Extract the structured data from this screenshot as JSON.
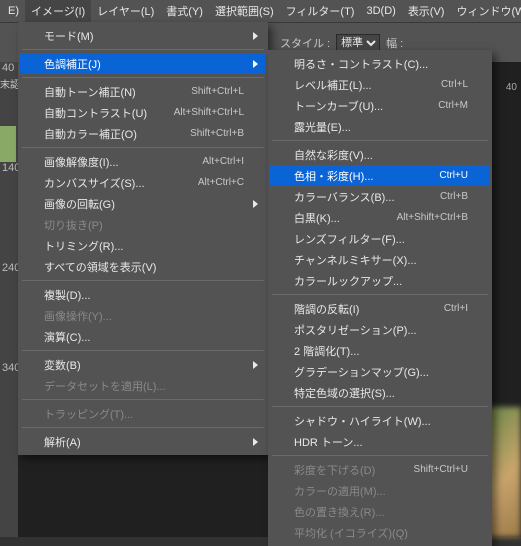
{
  "topbar": {
    "items": [
      "E)",
      "イメージ(I)",
      "レイヤー(L)",
      "書式(Y)",
      "選択範囲(S)",
      "フィルター(T)",
      "3D(D)",
      "表示(V)",
      "ウィンドウ(W)"
    ]
  },
  "optbar": {
    "style_label": "スタイル :",
    "style_value": "標準",
    "width_label": "幅 :"
  },
  "ruler": {
    "t0": "40",
    "t1": "140",
    "t2": "240",
    "t3": "340",
    "t4": "40"
  },
  "partial_left": "末認",
  "menu1": [
    {
      "label": "モード(M)",
      "shortcut": "",
      "arrow": true
    },
    "sep",
    {
      "label": "色調補正(J)",
      "shortcut": "",
      "arrow": true,
      "hl": true
    },
    "sep",
    {
      "label": "自動トーン補正(N)",
      "shortcut": "Shift+Ctrl+L"
    },
    {
      "label": "自動コントラスト(U)",
      "shortcut": "Alt+Shift+Ctrl+L"
    },
    {
      "label": "自動カラー補正(O)",
      "shortcut": "Shift+Ctrl+B"
    },
    "sep",
    {
      "label": "画像解像度(I)...",
      "shortcut": "Alt+Ctrl+I"
    },
    {
      "label": "カンバスサイズ(S)...",
      "shortcut": "Alt+Ctrl+C"
    },
    {
      "label": "画像の回転(G)",
      "shortcut": "",
      "arrow": true
    },
    {
      "label": "切り抜き(P)",
      "shortcut": "",
      "disabled": true
    },
    {
      "label": "トリミング(R)...",
      "shortcut": ""
    },
    {
      "label": "すべての領域を表示(V)",
      "shortcut": ""
    },
    "sep",
    {
      "label": "複製(D)...",
      "shortcut": ""
    },
    {
      "label": "画像操作(Y)...",
      "shortcut": "",
      "disabled": true
    },
    {
      "label": "演算(C)...",
      "shortcut": ""
    },
    "sep",
    {
      "label": "変数(B)",
      "shortcut": "",
      "arrow": true
    },
    {
      "label": "データセットを適用(L)...",
      "shortcut": "",
      "disabled": true
    },
    "sep",
    {
      "label": "トラッピング(T)...",
      "shortcut": "",
      "disabled": true
    },
    "sep",
    {
      "label": "解析(A)",
      "shortcut": "",
      "arrow": true
    }
  ],
  "menu2": [
    {
      "label": "明るさ・コントラスト(C)...",
      "shortcut": ""
    },
    {
      "label": "レベル補正(L)...",
      "shortcut": "Ctrl+L"
    },
    {
      "label": "トーンカーブ(U)...",
      "shortcut": "Ctrl+M"
    },
    {
      "label": "露光量(E)...",
      "shortcut": ""
    },
    "sep",
    {
      "label": "自然な彩度(V)...",
      "shortcut": ""
    },
    {
      "label": "色相・彩度(H)...",
      "shortcut": "Ctrl+U",
      "hl": true
    },
    {
      "label": "カラーバランス(B)...",
      "shortcut": "Ctrl+B"
    },
    {
      "label": "白黒(K)...",
      "shortcut": "Alt+Shift+Ctrl+B"
    },
    {
      "label": "レンズフィルター(F)...",
      "shortcut": ""
    },
    {
      "label": "チャンネルミキサー(X)...",
      "shortcut": ""
    },
    {
      "label": "カラールックアップ...",
      "shortcut": ""
    },
    "sep",
    {
      "label": "階調の反転(I)",
      "shortcut": "Ctrl+I"
    },
    {
      "label": "ポスタリゼーション(P)...",
      "shortcut": ""
    },
    {
      "label": "2 階調化(T)...",
      "shortcut": ""
    },
    {
      "label": "グラデーションマップ(G)...",
      "shortcut": ""
    },
    {
      "label": "特定色域の選択(S)...",
      "shortcut": ""
    },
    "sep",
    {
      "label": "シャドウ・ハイライト(W)...",
      "shortcut": ""
    },
    {
      "label": "HDR トーン...",
      "shortcut": ""
    },
    "sep",
    {
      "label": "彩度を下げる(D)",
      "shortcut": "Shift+Ctrl+U",
      "disabled": true
    },
    {
      "label": "カラーの適用(M)...",
      "shortcut": "",
      "disabled": true
    },
    {
      "label": "色の置き換え(R)...",
      "shortcut": "",
      "disabled": true
    },
    {
      "label": "平均化 (イコライズ)(Q)",
      "shortcut": "",
      "disabled": true
    }
  ]
}
